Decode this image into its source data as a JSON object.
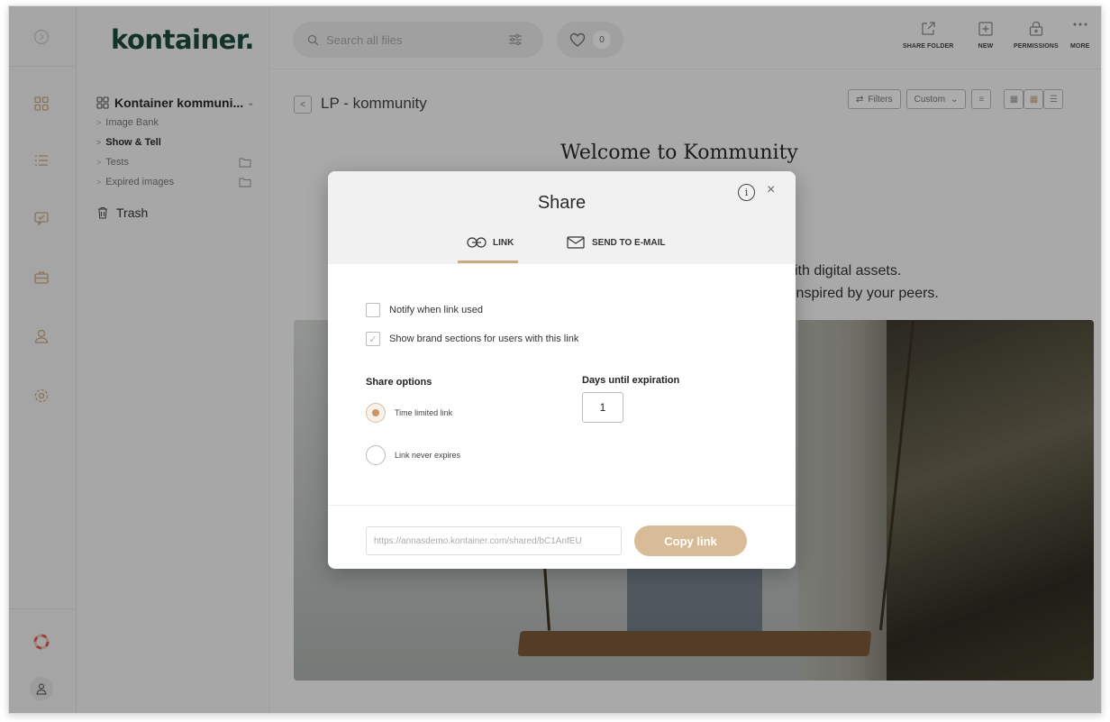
{
  "brand": {
    "logo": "kontainer.",
    "accent": "#c8ab86",
    "logo_color": "#1c4a3e"
  },
  "sidebar": {
    "root": "Kontainer kommuni...",
    "items": [
      {
        "label": "Image Bank"
      },
      {
        "label": "Show & Tell"
      },
      {
        "label": "Tests"
      },
      {
        "label": "Expired images"
      }
    ],
    "trash": "Trash"
  },
  "topbar": {
    "search_placeholder": "Search all files",
    "favorites_count": "0",
    "actions": [
      "SHARE FOLDER",
      "NEW",
      "PERMISSIONS",
      "MORE"
    ]
  },
  "content": {
    "breadcrumb": "LP - kommunity",
    "filters_label": "Filters",
    "sort_label": "Custom",
    "welcome": "Welcome to Kommunity",
    "sub1": "ith digital assets.",
    "sub2": "inspired by your peers."
  },
  "modal": {
    "title": "Share",
    "tabs": [
      "LINK",
      "SEND TO E-MAIL"
    ],
    "notify_label": "Notify when link used",
    "notify_checked": false,
    "brand_sections_label": "Show brand sections for users with this link",
    "brand_sections_checked": true,
    "share_options_label": "Share options",
    "days_label": "Days until expiration",
    "days_value": "1",
    "option_time_limited": "Time limited link",
    "option_never": "Link never expires",
    "selected_option": "Time limited link",
    "link_url": "https://annasdemo.kontainer.com/shared/bC1AnfEU",
    "copy_label": "Copy link"
  }
}
